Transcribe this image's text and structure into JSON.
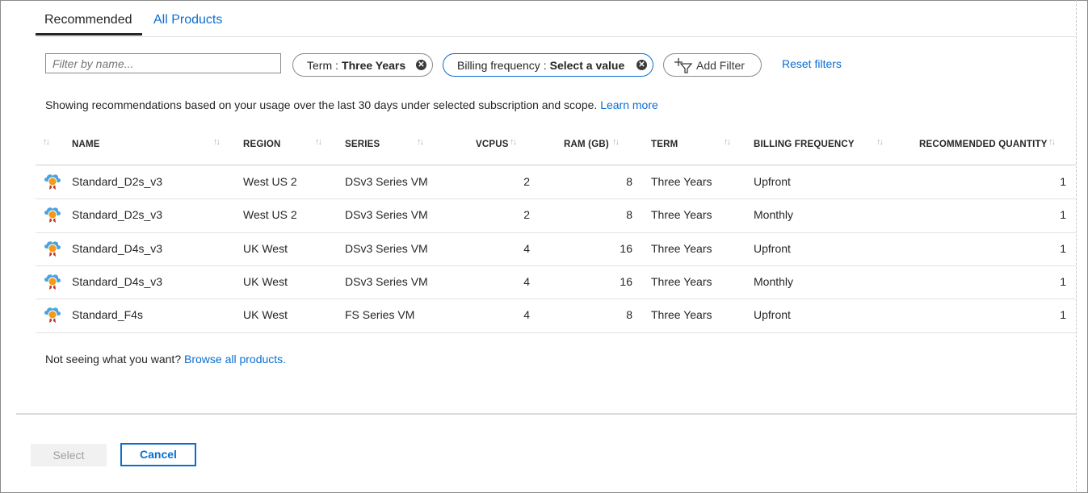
{
  "tabs": [
    {
      "label": "Recommended",
      "active": true
    },
    {
      "label": "All Products",
      "active": false
    }
  ],
  "filters": {
    "name_placeholder": "Filter by name...",
    "term": {
      "key": "Term",
      "sep": ":",
      "value": "Three Years"
    },
    "billing": {
      "key": "Billing frequency",
      "sep": ":",
      "value": "Select a value"
    },
    "add_filter_label": "Add Filter",
    "reset_label": "Reset filters"
  },
  "info": {
    "text": "Showing recommendations based on your usage over the last 30 days under selected subscription and scope.",
    "link": "Learn more"
  },
  "table": {
    "columns": [
      "NAME",
      "REGION",
      "SERIES",
      "VCPUS",
      "RAM (GB)",
      "TERM",
      "BILLING FREQUENCY",
      "RECOMMENDED QUANTITY"
    ],
    "rows": [
      {
        "name": "Standard_D2s_v3",
        "region": "West US 2",
        "series": "DSv3 Series VM",
        "vcpus": "2",
        "ram": "8",
        "term": "Three Years",
        "billing": "Upfront",
        "qty": "1"
      },
      {
        "name": "Standard_D2s_v3",
        "region": "West US 2",
        "series": "DSv3 Series VM",
        "vcpus": "2",
        "ram": "8",
        "term": "Three Years",
        "billing": "Monthly",
        "qty": "1"
      },
      {
        "name": "Standard_D4s_v3",
        "region": "UK West",
        "series": "DSv3 Series VM",
        "vcpus": "4",
        "ram": "16",
        "term": "Three Years",
        "billing": "Upfront",
        "qty": "1"
      },
      {
        "name": "Standard_D4s_v3",
        "region": "UK West",
        "series": "DSv3 Series VM",
        "vcpus": "4",
        "ram": "16",
        "term": "Three Years",
        "billing": "Monthly",
        "qty": "1"
      },
      {
        "name": "Standard_F4s",
        "region": "UK West",
        "series": "FS Series VM",
        "vcpus": "4",
        "ram": "8",
        "term": "Three Years",
        "billing": "Upfront",
        "qty": "1"
      }
    ],
    "row_icon": "reserved-vm-icon",
    "sort_icon": "sort-arrows-icon"
  },
  "browse": {
    "text": "Not seeing what you want?",
    "link": "Browse all products."
  },
  "buttons": {
    "select": "Select",
    "cancel": "Cancel"
  },
  "colors": {
    "accent": "#0a6ed1",
    "text": "#262626",
    "border": "#8a8a8a",
    "cloud": "#4aa3df",
    "badge": "#f29b1b",
    "ribbon": "#c0392b"
  }
}
